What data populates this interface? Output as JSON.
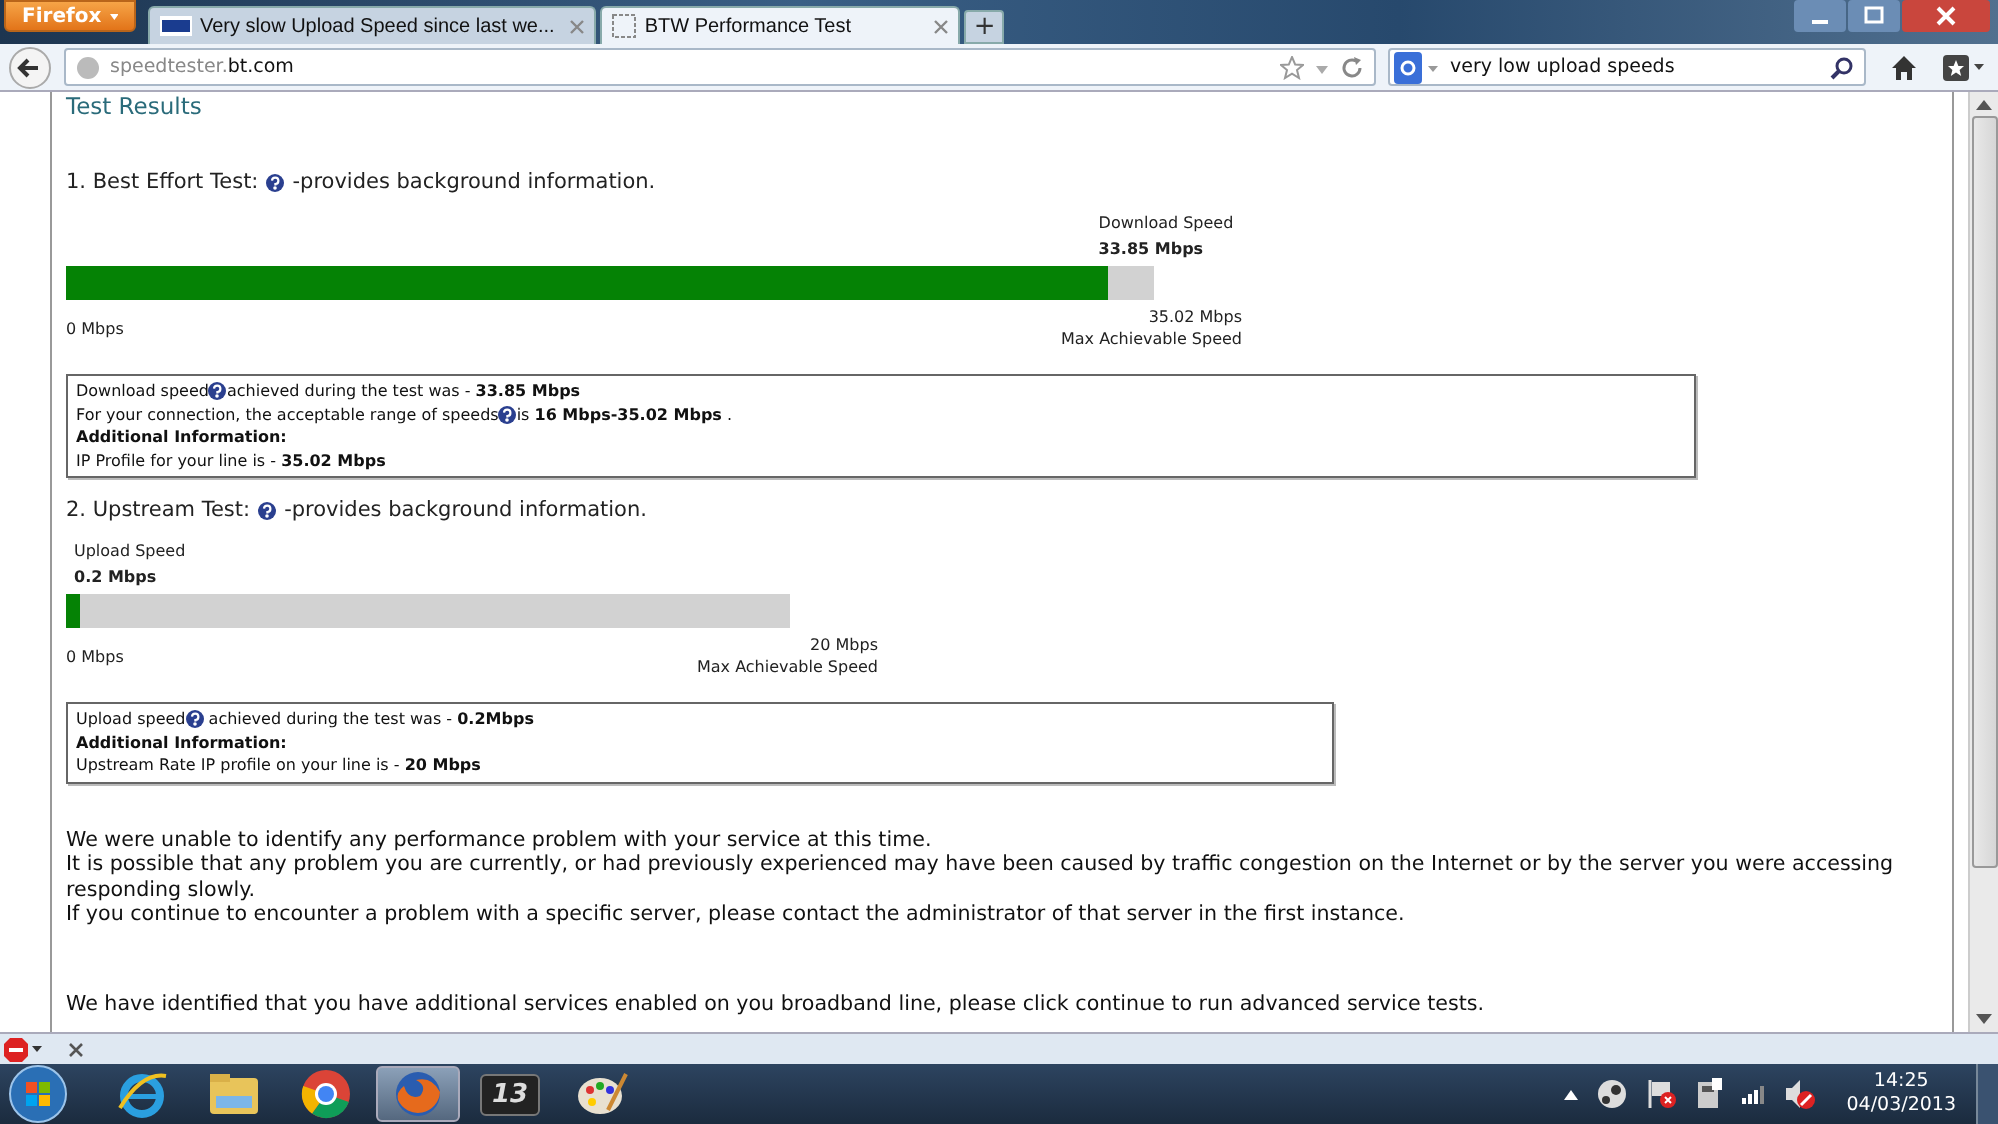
{
  "browser": {
    "menu_button": "Firefox",
    "tabs": [
      {
        "title": "Very slow Upload Speed since last we...",
        "selected": false,
        "kind": "bt"
      },
      {
        "title": "BTW Performance Test",
        "selected": true,
        "kind": "blank"
      }
    ],
    "new_tab": "+",
    "address": {
      "host_prefix": "speedtester.",
      "domain": "bt.com"
    },
    "search": {
      "value": "very low upload speeds"
    }
  },
  "page": {
    "heading": "Test Results",
    "tests": [
      {
        "title": "1. Best Effort Test:",
        "note": "-provides background information.",
        "gauge_label": "Download Speed",
        "gauge_value": "33.85 Mbps",
        "level": 0.958,
        "min": "0 Mbps",
        "max": "35.02 Mbps",
        "max_label": "Max Achievable Speed",
        "info": [
          {
            "kind": "text",
            "parts": [
              {
                "kind": "text",
                "text": "Download speed"
              },
              {
                "kind": "help"
              },
              {
                "kind": "text",
                "text": "achieved during the test was - **33.85 Mbps**"
              }
            ]
          },
          {
            "kind": "text",
            "parts": [
              {
                "kind": "text",
                "text": "For your connection, the acceptable range of speeds"
              },
              {
                "kind": "help"
              },
              {
                "kind": "text",
                "text": "is **16 Mbps-35.02 Mbps** ."
              }
            ]
          },
          {
            "kind": "heading",
            "parts": [
              {
                "kind": "text",
                "text": "Additional Information:"
              }
            ]
          },
          {
            "kind": "text",
            "parts": [
              {
                "kind": "text",
                "text": "IP Profile for your line is - **35.02 Mbps**"
              }
            ]
          }
        ]
      },
      {
        "title": "2. Upstream Test:",
        "note": "-provides background information.",
        "gauge_label": "Upload Speed",
        "gauge_value": "0.2 Mbps",
        "level": 0.02,
        "min": "0 Mbps",
        "max": "20 Mbps",
        "max_label": "Max Achievable Speed",
        "info": [
          {
            "kind": "text",
            "parts": [
              {
                "kind": "text",
                "text": "Upload speed"
              },
              {
                "kind": "help"
              },
              {
                "kind": "text",
                "text": " achieved during the test was - **0.2Mbps**"
              }
            ]
          },
          {
            "kind": "heading",
            "parts": [
              {
                "kind": "text",
                "text": "Additional Information:"
              }
            ]
          },
          {
            "kind": "text",
            "parts": [
              {
                "kind": "text",
                "text": "Upstream Rate IP profile on your line is - **20 Mbps**"
              }
            ]
          }
        ]
      }
    ],
    "messages": [
      "We were unable to identify any performance problem with your service at this time.",
      "It is possible that any problem you are currently, or had previously experienced may have been caused by traffic congestion on the Internet or by the server you were accessing responding slowly.",
      "If you continue to encounter a problem with a specific server, please contact the administrator of that server in the first instance."
    ],
    "footer_message": "We have identified that you have additional services enabled on you broadband line, please click continue to run advanced service tests."
  },
  "taskbar": {
    "apps": [
      {
        "kind": "ie",
        "active": false
      },
      {
        "kind": "folder",
        "active": false
      },
      {
        "kind": "chrome",
        "active": false
      },
      {
        "kind": "firefox",
        "active": true
      },
      {
        "kind": "game",
        "active": false,
        "label": "13"
      },
      {
        "kind": "paint",
        "active": false
      }
    ],
    "time": "14:25",
    "date": "04/03/2013"
  }
}
